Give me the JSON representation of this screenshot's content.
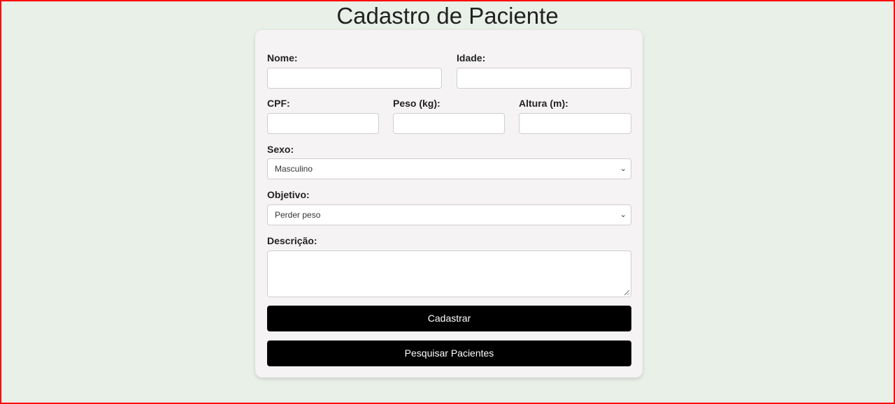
{
  "page": {
    "title": "Cadastro de Paciente"
  },
  "form": {
    "nome": {
      "label": "Nome:",
      "value": ""
    },
    "idade": {
      "label": "Idade:",
      "value": ""
    },
    "cpf": {
      "label": "CPF:",
      "value": ""
    },
    "peso": {
      "label": "Peso (kg):",
      "value": ""
    },
    "altura": {
      "label": "Altura (m):",
      "value": ""
    },
    "sexo": {
      "label": "Sexo:",
      "selected": "Masculino"
    },
    "objetivo": {
      "label": "Objetivo:",
      "selected": "Perder peso"
    },
    "descricao": {
      "label": "Descrição:",
      "value": ""
    }
  },
  "buttons": {
    "cadastrar": "Cadastrar",
    "pesquisar": "Pesquisar Pacientes"
  },
  "colors": {
    "background": "#e9f0e8",
    "card": "#f5f3f3",
    "button": "#000000",
    "frame_border": "#ff0000"
  },
  "icons": {
    "select_arrow": "chevron-down-icon",
    "textarea_resize": "resize-grip-icon"
  }
}
